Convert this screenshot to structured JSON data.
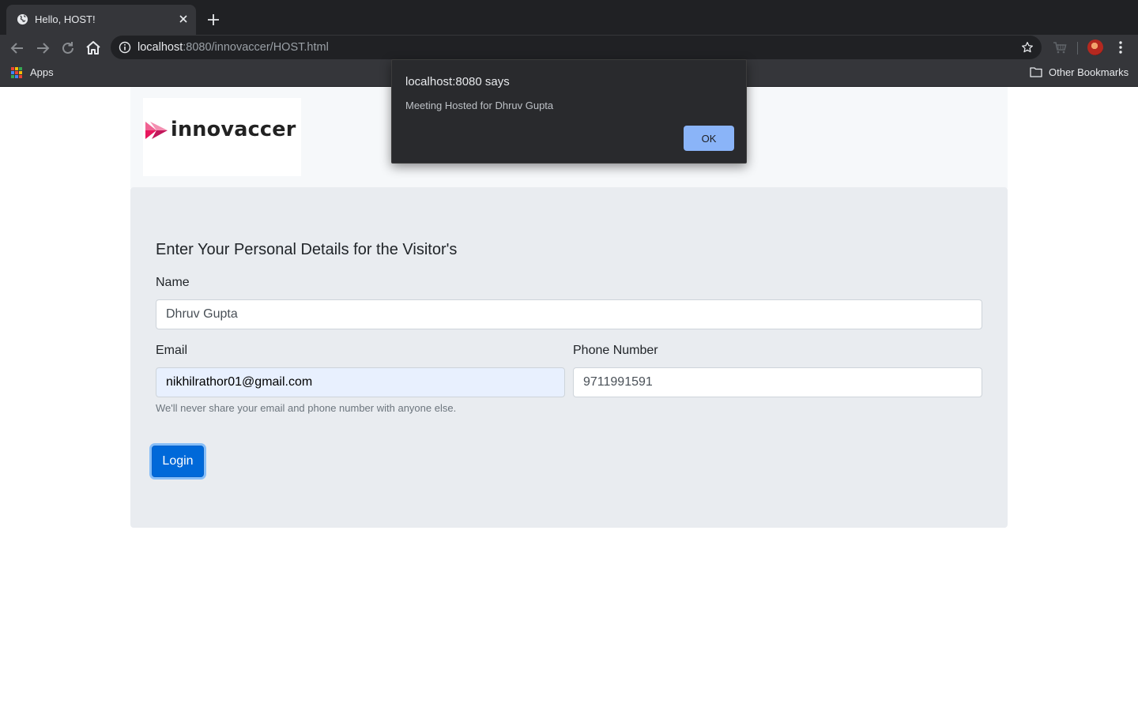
{
  "browser": {
    "tab_title": "Hello, HOST!",
    "url_host": "localhost",
    "url_rest": ":8080/innovaccer/HOST.html",
    "bookmarks": {
      "apps_label": "Apps",
      "other_label": "Other Bookmarks"
    }
  },
  "page": {
    "logo_text": "innovaccer",
    "brand_color": "#e8175d",
    "form": {
      "heading": "Enter Your Personal Details for the Visitor's",
      "name_label": "Name",
      "name_value": "Dhruv Gupta",
      "email_label": "Email",
      "email_value": "nikhilrathor01@gmail.com",
      "phone_label": "Phone Number",
      "phone_value": "9711991591",
      "help_text": "We'll never share your email and phone number with anyone else.",
      "submit_label": "Login"
    }
  },
  "alert": {
    "title": "localhost:8080 says",
    "message": "Meeting Hosted for Dhruv Gupta",
    "ok_label": "OK"
  },
  "icons": {
    "favicon": "globe-icon",
    "close": "close-icon",
    "new_tab": "plus-icon",
    "back": "arrow-left-icon",
    "forward": "arrow-right-icon",
    "reload": "reload-icon",
    "home": "home-icon",
    "info": "info-icon",
    "bookmark": "star-icon",
    "extension": "cart-icon",
    "menu": "kebab-menu-icon",
    "apps": "apps-grid-icon",
    "folder": "folder-icon"
  }
}
